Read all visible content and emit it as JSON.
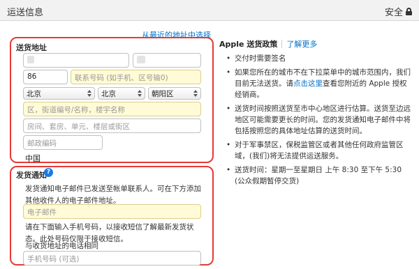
{
  "header": {
    "title": "运送信息",
    "secure_label": "安全",
    "secure_icon": "lock-icon"
  },
  "shipping": {
    "recent_address_link": "从最近的地址中选择",
    "section_label": "送货地址",
    "country_code": "86",
    "phone_placeholder": "联系号码 (如手机、区号输0)",
    "province": "北京",
    "city": "北京",
    "district": "朝阳区",
    "street_placeholder": "区，街道编号/名称，楼宇名称",
    "unit_placeholder": "房间、套房、单元、楼层或街区",
    "postal_placeholder": "邮政编码",
    "country": "中国"
  },
  "notice": {
    "section_label": "发货通知",
    "help_icon": "question-icon",
    "email_text": "发货通知电子邮件已发送至帐单联系人。可在下方添加其他收件人的电子邮件地址。",
    "email_placeholder": "电子邮件",
    "sms_text": "请在下面输入手机号码，以接收短信了解最新发货状态。此处号码仅限于接收短信。",
    "same_phone_link": "与收货地址的电话相同",
    "mobile_placeholder": "手机号码 (可选)"
  },
  "policy": {
    "title": "Apple 送货政策",
    "learn_more": "了解更多",
    "items": [
      {
        "text": "交付时需要签名"
      },
      {
        "text_before": "如果您所在的城市不在下拉菜单中的城市范围内，我们目前无法送货。请",
        "link": "点击这里",
        "text_after": "查看您附近的 Apple 授权经销商。"
      },
      {
        "text": "送货时间按照送货至市中心地区进行估算。送货至边远地区可能需要更长的时间。您的发货通知电子邮件中将包括按照您的具体地址估算的送货时间。"
      },
      {
        "text": "对于军事禁区，保税监管区或者其他任何政府监管区域，(我们)将无法提供运送服务。"
      },
      {
        "text": "送货时间：星期一至星期日 上午 8:30 至下午 5:30 (公众假期暂停交货)"
      }
    ]
  }
}
